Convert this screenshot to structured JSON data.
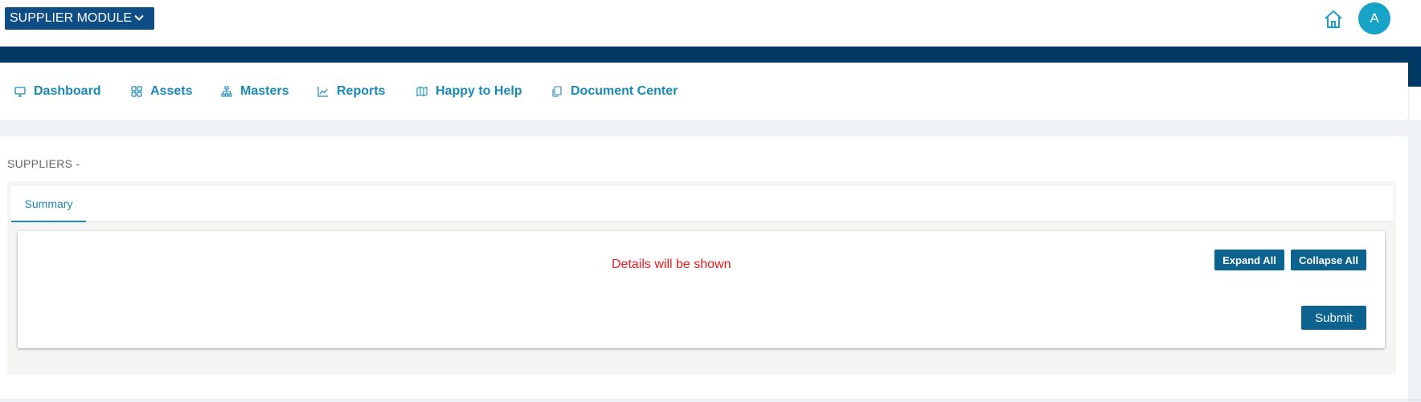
{
  "header": {
    "module_selector": {
      "label": "SUPPLIER MODULE",
      "icon": "chevron-down-icon"
    },
    "home_icon": "home-icon",
    "avatar_initial": "A"
  },
  "nav": {
    "items": [
      {
        "label": "Dashboard",
        "icon": "monitor-icon"
      },
      {
        "label": "Assets",
        "icon": "grid-icon"
      },
      {
        "label": "Masters",
        "icon": "sitemap-icon"
      },
      {
        "label": "Reports",
        "icon": "chart-line-icon"
      },
      {
        "label": "Happy to Help",
        "icon": "map-icon"
      },
      {
        "label": "Document Center",
        "icon": "documents-icon"
      }
    ]
  },
  "page": {
    "heading": "SUPPLIERS -",
    "tabs": [
      {
        "label": "Summary",
        "active": true
      }
    ],
    "details_message": "Details will be shown",
    "buttons": {
      "expand_all": "Expand All",
      "collapse_all": "Collapse All",
      "submit": "Submit"
    }
  },
  "colors": {
    "brand_dark": "#003a64",
    "module_button": "#0e4d86",
    "accent": "#1a88b8",
    "avatar": "#16a3c6",
    "button": "#0d6390",
    "message": "#ee1c1c"
  }
}
